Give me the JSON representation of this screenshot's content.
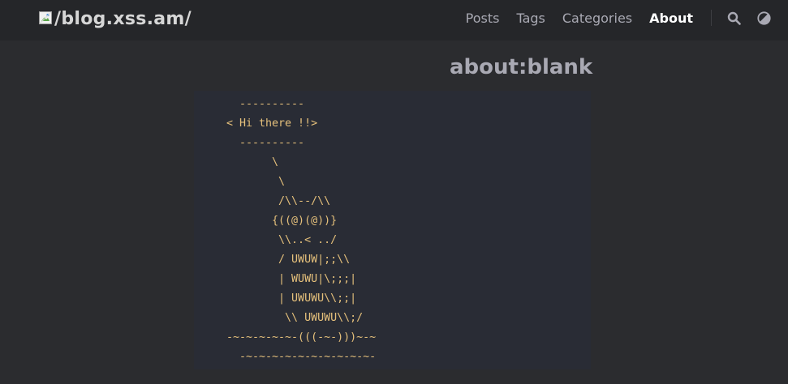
{
  "header": {
    "logo_text": "/blog.xss.am/",
    "nav": [
      {
        "label": "Posts"
      },
      {
        "label": "Tags"
      },
      {
        "label": "Categories"
      },
      {
        "label": "About",
        "active": true
      }
    ],
    "icons": [
      "search-icon",
      "theme-toggle-icon"
    ]
  },
  "page": {
    "title": "about:blank",
    "ascii_art": "  ----------\n< Hi there !!>\n  ----------\n       \\\n        \\\n        /\\\\--/\\\\\n       {((@)(@))}\n        \\\\..< ../\n        / UWUW|;;\\\\\n        | WUWU|\\;;;|\n        | UWUWU\\\\;;|\n         \\\\ UWUWU\\\\;/\n-~-~-~-~-~-(((-~-)))~-~\n  -~-~-~-~-~-~-~-~-~-~-"
  },
  "colors": {
    "background": "#2b2c2f",
    "header_background": "#252629",
    "code_background": "#292c35",
    "code_text": "#e5c07b",
    "nav_text": "#a9a9b3",
    "nav_active": "#ffffff"
  }
}
